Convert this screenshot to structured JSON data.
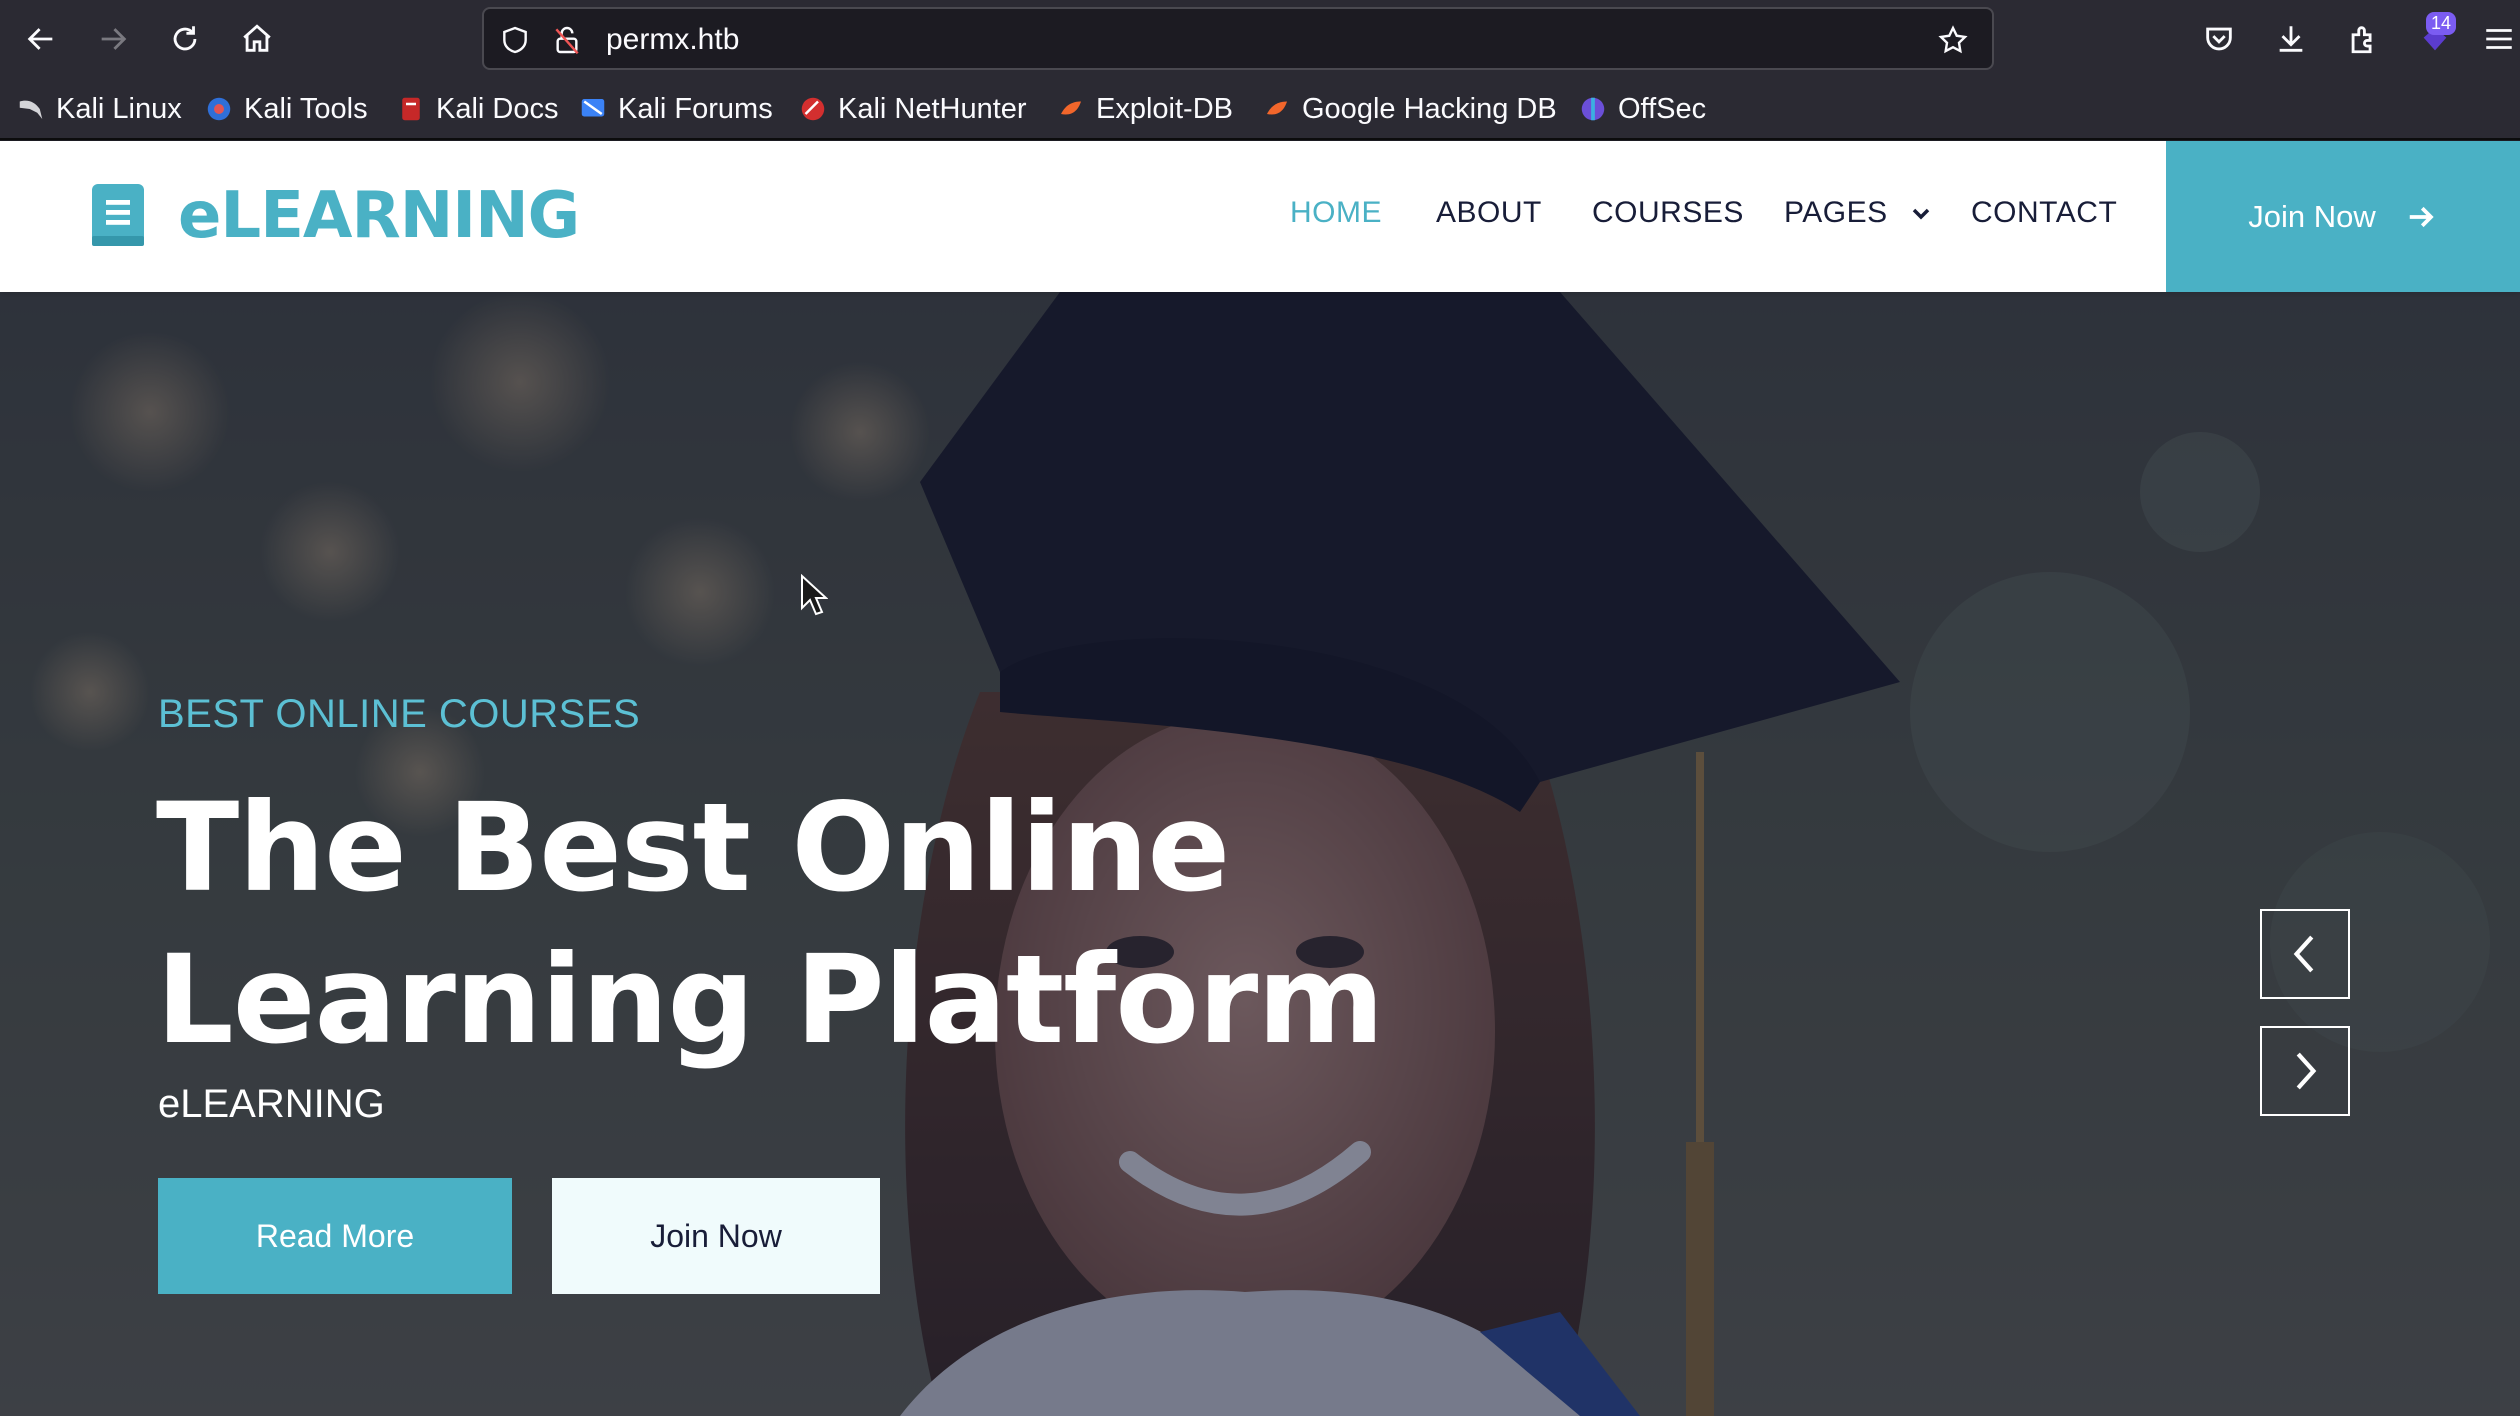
{
  "browser": {
    "url": "permx.htb",
    "extensions_badge": "14",
    "bookmarks": [
      {
        "label": "Kali Linux",
        "icon": "kali-dragon-icon"
      },
      {
        "label": "Kali Tools",
        "icon": "kali-tools-icon"
      },
      {
        "label": "Kali Docs",
        "icon": "kali-docs-icon"
      },
      {
        "label": "Kali Forums",
        "icon": "kali-forums-icon"
      },
      {
        "label": "Kali NetHunter",
        "icon": "kali-nethunter-icon"
      },
      {
        "label": "Exploit-DB",
        "icon": "exploit-db-icon"
      },
      {
        "label": "Google Hacking DB",
        "icon": "ghdb-icon"
      },
      {
        "label": "OffSec",
        "icon": "offsec-icon"
      }
    ]
  },
  "site": {
    "brand": "eLEARNING",
    "nav": [
      {
        "label": "HOME",
        "active": true
      },
      {
        "label": "ABOUT",
        "active": false
      },
      {
        "label": "COURSES",
        "active": false
      },
      {
        "label": "PAGES",
        "active": false,
        "dropdown": true
      },
      {
        "label": "CONTACT",
        "active": false
      }
    ],
    "join_button": "Join Now",
    "accent_color": "#4ab1c5",
    "dark_color": "#181d38"
  },
  "hero": {
    "subtitle": "BEST ONLINE COURSES",
    "title_line1": "The Best Online",
    "title_line2": "Learning Platform",
    "brand_text": "eLEARNING",
    "read_more": "Read More",
    "join_now": "Join Now"
  }
}
